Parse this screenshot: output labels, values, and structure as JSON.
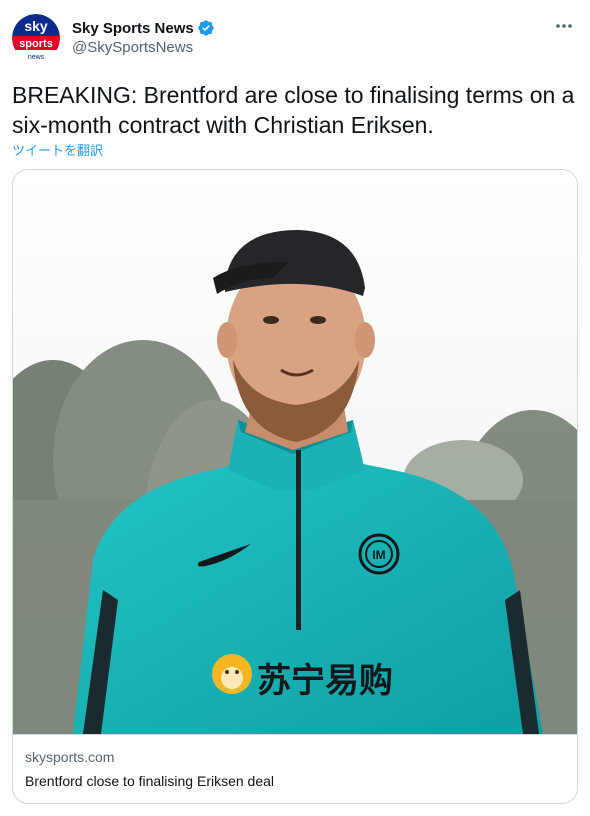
{
  "author": {
    "display_name": "Sky Sports News",
    "handle": "@SkySportsNews",
    "verified": true,
    "avatar_logo": {
      "line1": "sky",
      "line2": "sports",
      "line3": "news"
    }
  },
  "menu": {
    "icon": "more-horizontal-icon"
  },
  "tweet": {
    "text": "BREAKING: Brentford are close to finalising terms on a six-month contract with Christian Eriksen.",
    "translate_label": "ツイートを翻訳"
  },
  "card": {
    "domain": "skysports.com",
    "title": "Brentford close to finalising Eriksen deal",
    "image_description_icon": "photo-icon"
  },
  "colors": {
    "link_blue": "#1d9bf0",
    "secondary_text": "#536471",
    "border": "#cfd9de",
    "verified_blue": "#1d9bf0",
    "jacket_teal": "#15b5b8"
  }
}
